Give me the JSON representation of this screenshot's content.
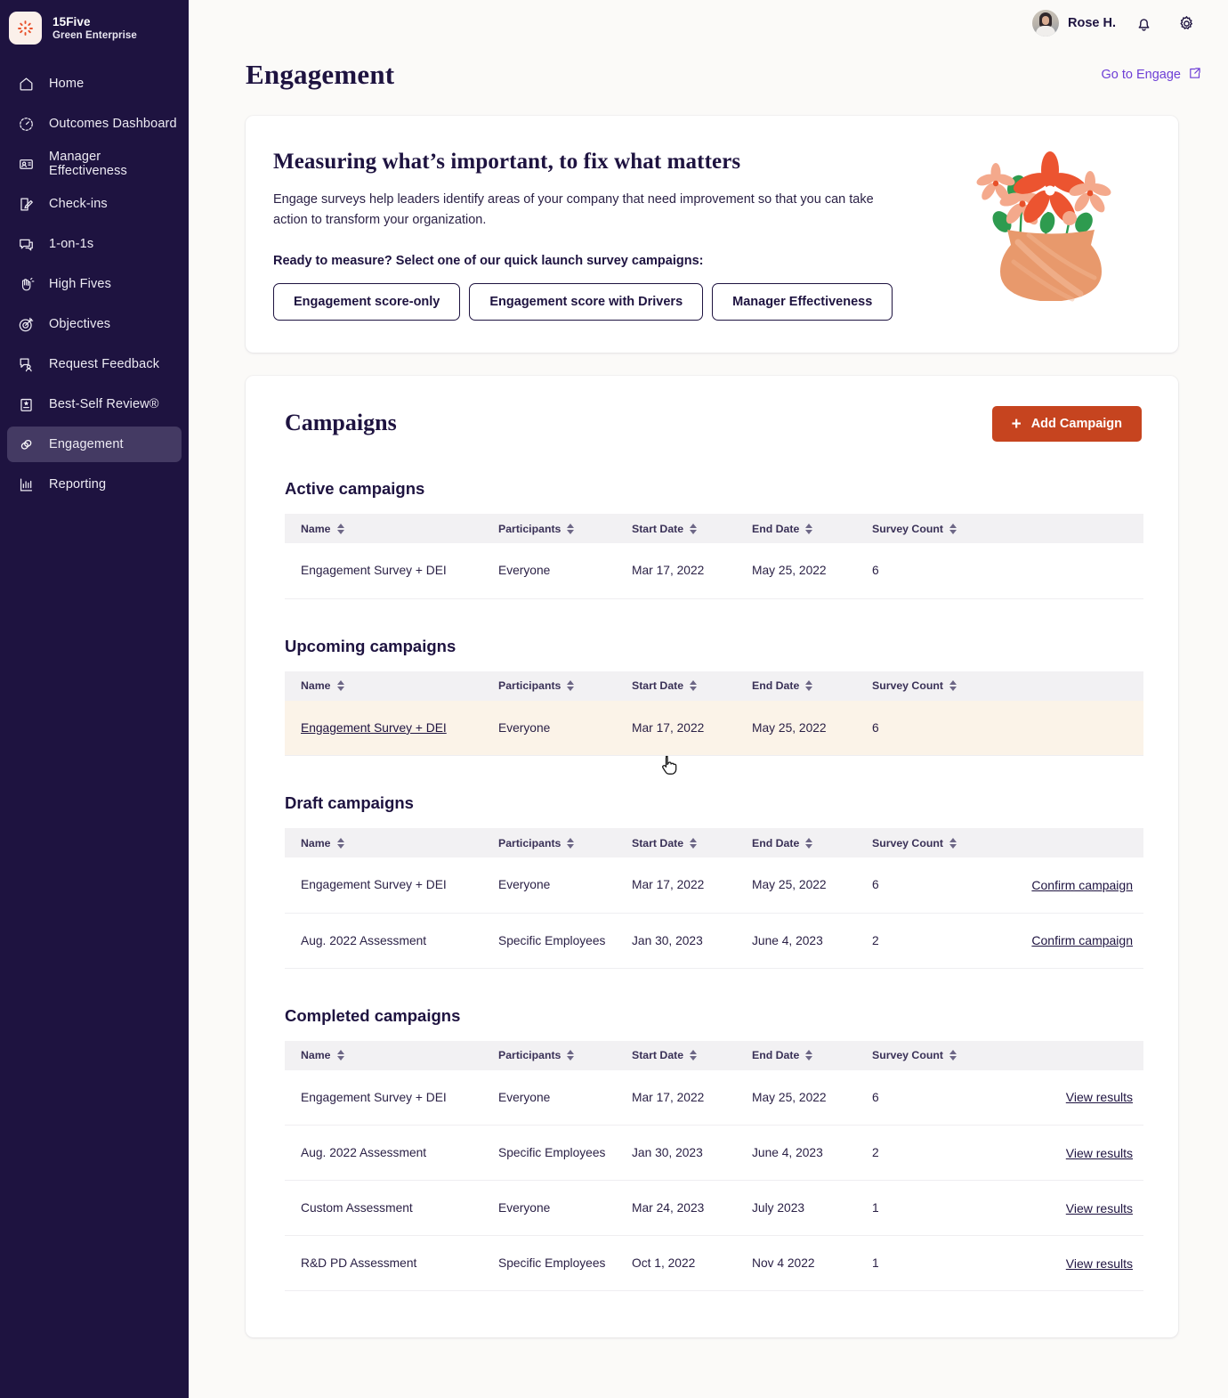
{
  "sidebar": {
    "brand": {
      "name": "15Five",
      "org": "Green Enterprise",
      "logo_icon": "15five-starburst-logo"
    },
    "items": [
      {
        "label": "Home",
        "icon": "home-icon",
        "active": false
      },
      {
        "label": "Outcomes Dashboard",
        "icon": "gauge-icon",
        "active": false
      },
      {
        "label": "Manager Effectiveness",
        "icon": "manager-card-icon",
        "active": false
      },
      {
        "label": "Check-ins",
        "icon": "checkin-pencil-icon",
        "active": false
      },
      {
        "label": "1-on-1s",
        "icon": "chat-bubble-icon",
        "active": false
      },
      {
        "label": "High Fives",
        "icon": "high-five-hand-icon",
        "active": false
      },
      {
        "label": "Objectives",
        "icon": "target-icon",
        "active": false
      },
      {
        "label": "Request Feedback",
        "icon": "feedback-person-icon",
        "active": false
      },
      {
        "label": "Best-Self Review®",
        "icon": "review-clipboard-icon",
        "active": false
      },
      {
        "label": "Engagement",
        "icon": "engagement-rings-icon",
        "active": true
      },
      {
        "label": "Reporting",
        "icon": "bar-chart-icon",
        "active": false
      }
    ]
  },
  "topbar": {
    "user_name": "Rose H.",
    "avatar_icon": "user-avatar",
    "bell_icon": "notification-bell-icon",
    "gear_icon": "settings-gear-icon"
  },
  "page": {
    "title": "Engagement",
    "go_to_engage": "Go to Engage",
    "external_link_icon": "external-link-icon"
  },
  "hero": {
    "title": "Measuring what’s important, to fix what matters",
    "body": "Engage surveys help leaders identify areas of your company  that need improvement so that you can take action to transform your organization.",
    "prompt": "Ready to measure? Select one of our quick launch survey campaigns:",
    "buttons": [
      "Engagement score-only",
      "Engagement score with Drivers",
      "Manager Effectiveness"
    ],
    "illustration_icon": "flower-vase-illustration"
  },
  "campaigns": {
    "title": "Campaigns",
    "add_button": "Add Campaign",
    "add_icon": "plus-icon",
    "columns": [
      "Name",
      "Participants",
      "Start Date",
      "End Date",
      "Survey Count"
    ],
    "sort_icon": "sort-updown-icon",
    "sections": [
      {
        "title": "Active campaigns",
        "has_action": false,
        "rows": [
          {
            "name": "Engagement Survey + DEI",
            "participants": "Everyone",
            "start": "Mar 17, 2022",
            "end": "May 25, 2022",
            "count": "6",
            "action": "",
            "hovered": false
          }
        ]
      },
      {
        "title": "Upcoming campaigns",
        "has_action": false,
        "rows": [
          {
            "name": "Engagement Survey + DEI",
            "participants": "Everyone",
            "start": "Mar 17, 2022",
            "end": "May 25, 2022",
            "count": "6",
            "action": "",
            "hovered": true
          }
        ]
      },
      {
        "title": "Draft campaigns",
        "has_action": true,
        "rows": [
          {
            "name": "Engagement Survey + DEI",
            "participants": "Everyone",
            "start": "Mar 17, 2022",
            "end": "May 25, 2022",
            "count": "6",
            "action": "Confirm campaign",
            "hovered": false
          },
          {
            "name": "Aug. 2022 Assessment",
            "participants": "Specific Employees",
            "start": "Jan 30, 2023",
            "end": "June 4, 2023",
            "count": "2",
            "action": "Confirm campaign",
            "hovered": false
          }
        ]
      },
      {
        "title": "Completed campaigns",
        "has_action": true,
        "rows": [
          {
            "name": "Engagement Survey + DEI",
            "participants": "Everyone",
            "start": "Mar 17, 2022",
            "end": "May 25, 2022",
            "count": "6",
            "action": "View results",
            "hovered": false
          },
          {
            "name": "Aug. 2022 Assessment",
            "participants": "Specific Employees",
            "start": "Jan 30, 2023",
            "end": "June 4, 2023",
            "count": "2",
            "action": "View results",
            "hovered": false
          },
          {
            "name": "Custom Assessment",
            "participants": "Everyone",
            "start": "Mar 24, 2023",
            "end": "July 2023",
            "count": "1",
            "action": "View results",
            "hovered": false
          },
          {
            "name": "R&D PD Assessment",
            "participants": "Specific Employees",
            "start": "Oct 1, 2022",
            "end": "Nov 4 2022",
            "count": "1",
            "action": "View results",
            "hovered": false
          }
        ]
      }
    ]
  },
  "colors": {
    "sidebar_bg": "#1E1340",
    "sidebar_active": "#443A63",
    "accent_orange": "#C6441F",
    "link_purple": "#6E3FD6",
    "page_bg": "#FBFAF8",
    "row_hover": "#FBF3E8",
    "table_header_bg": "#F2F1F3"
  },
  "cursor": {
    "icon": "pointer-hand-cursor"
  }
}
